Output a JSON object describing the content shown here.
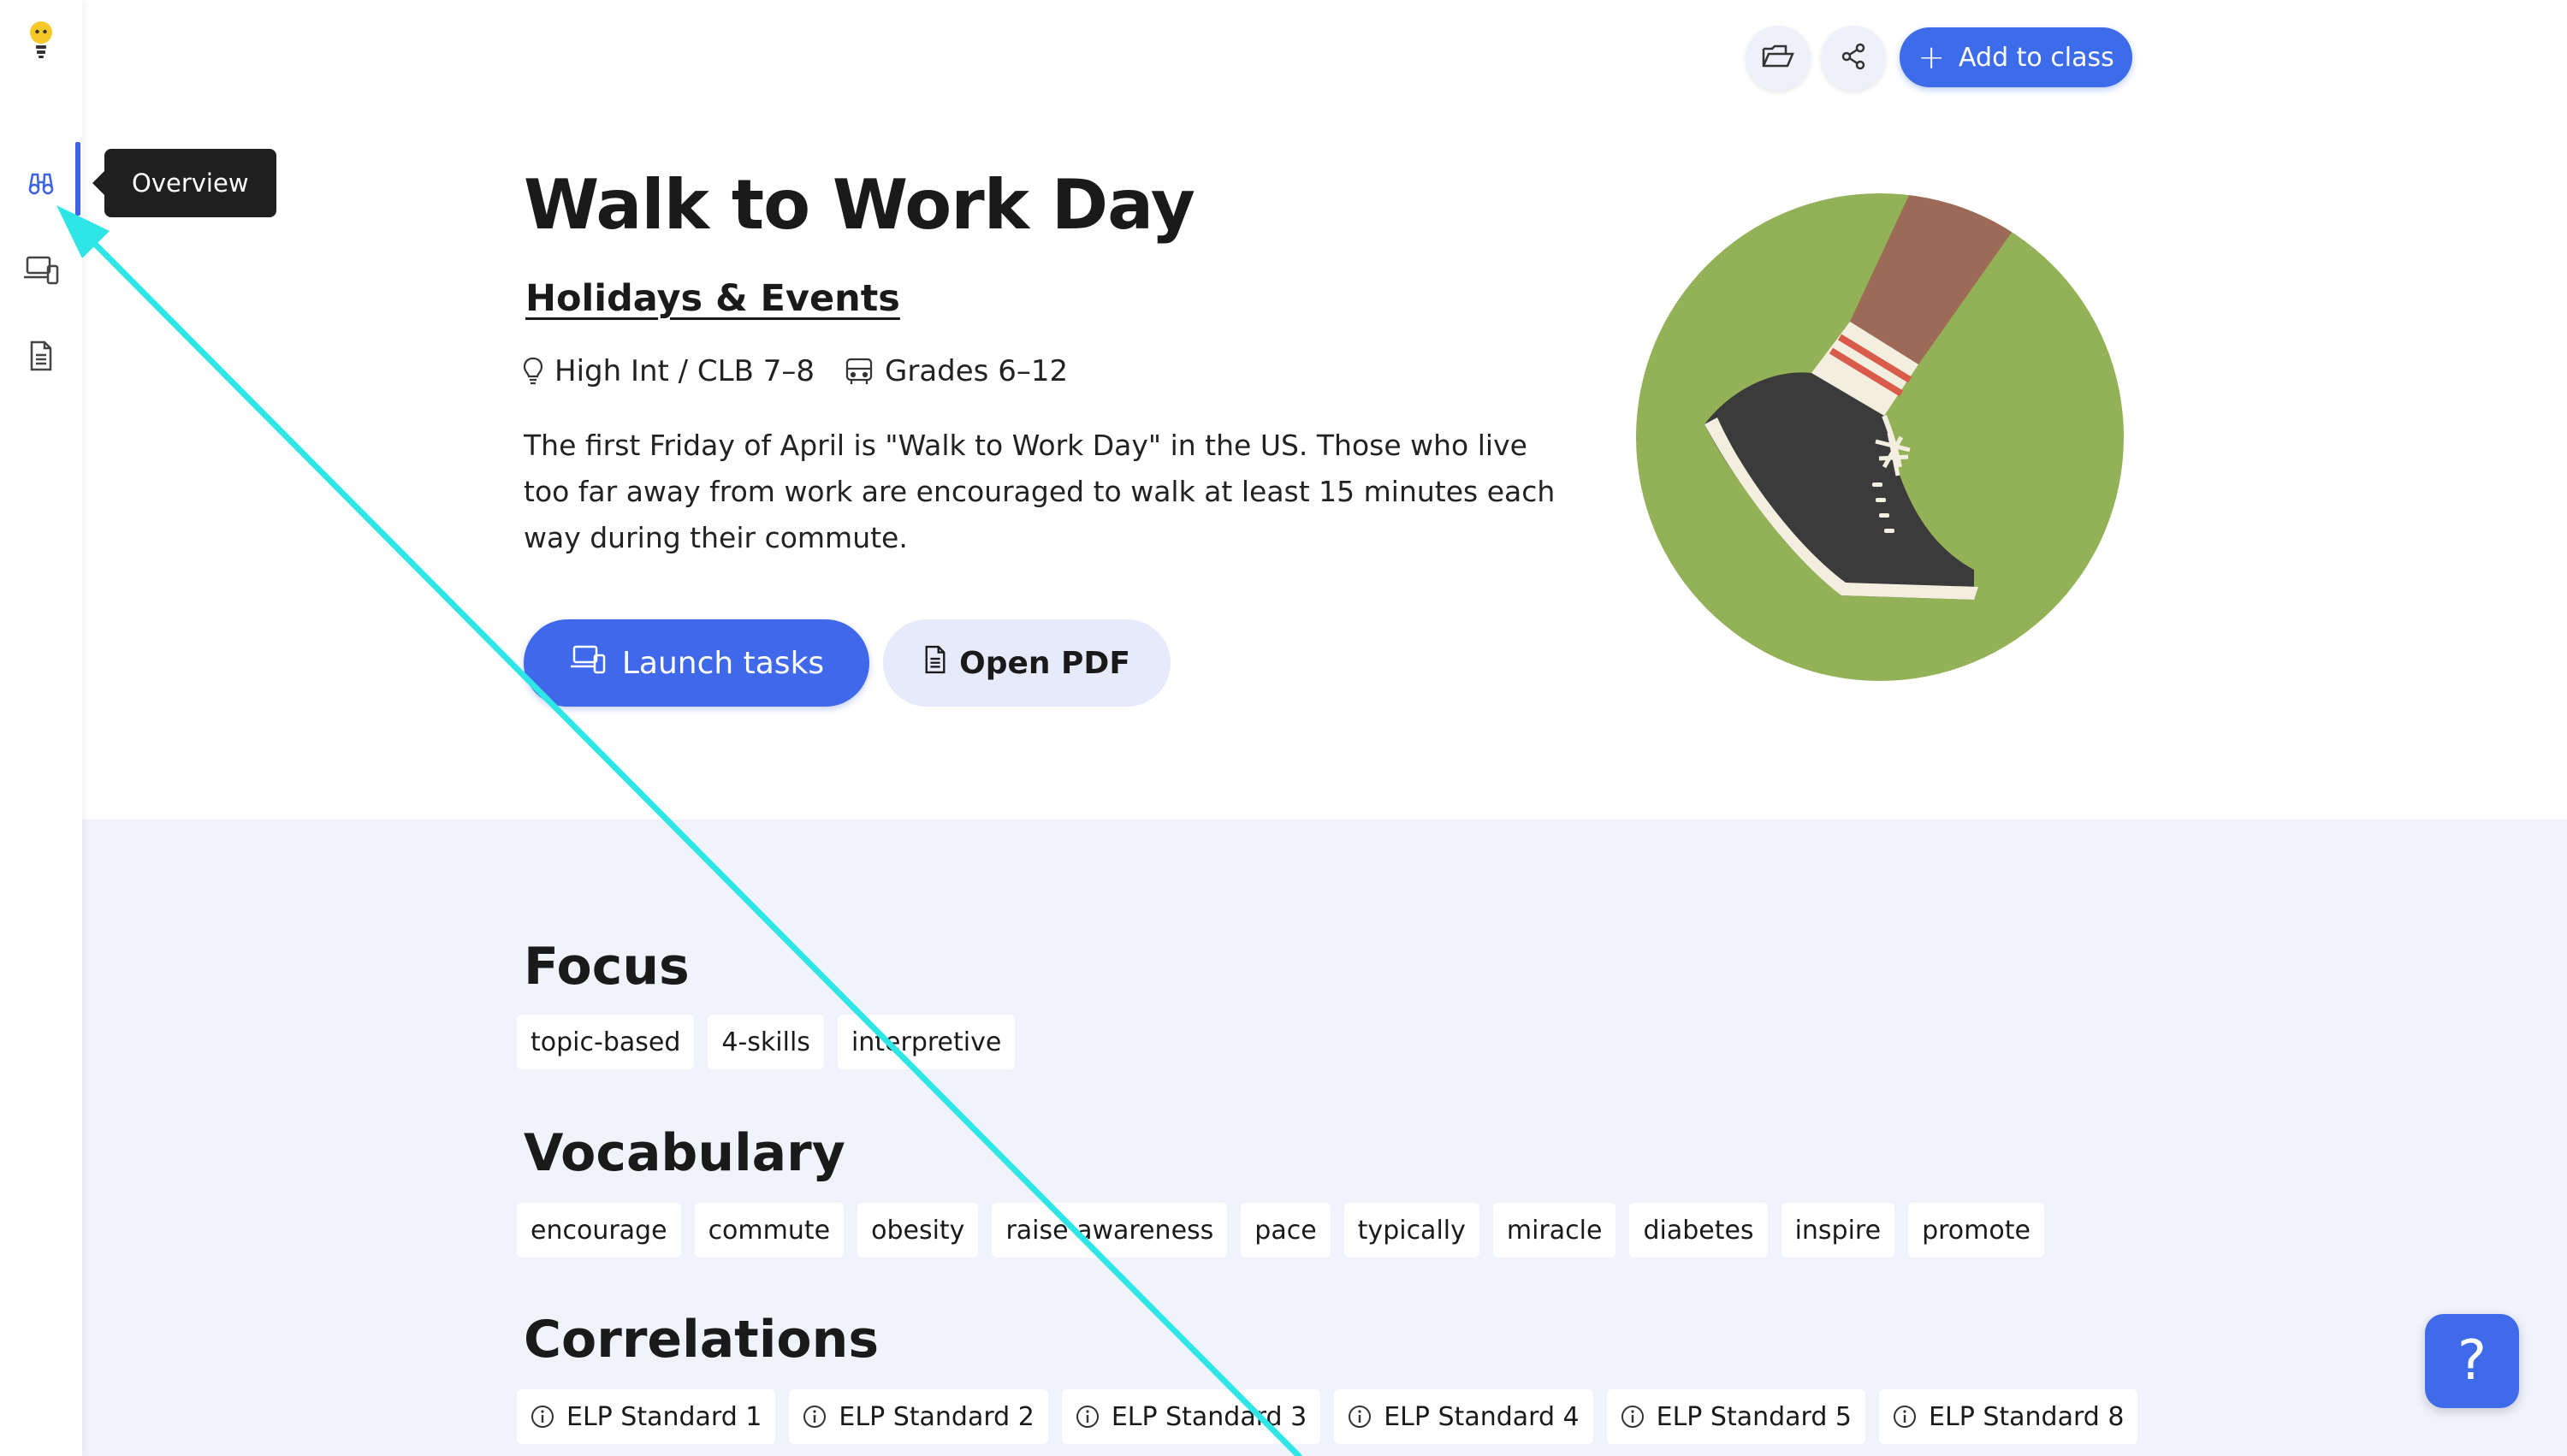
{
  "sidebar": {
    "items": [
      {
        "icon": "lightbulb-logo-icon"
      },
      {
        "icon": "binoculars-icon",
        "active": true
      },
      {
        "icon": "devices-icon"
      },
      {
        "icon": "document-icon"
      }
    ],
    "tooltip": "Overview"
  },
  "toolbar": {
    "folder_icon": "folder-open-icon",
    "share_icon": "share-icon",
    "add_label": "Add to class"
  },
  "lesson": {
    "title": "Walk to Work Day",
    "category": "Holidays & Events",
    "level": "High Int / CLB 7–8",
    "grades": "Grades 6–12",
    "description": "The first Friday of April is \"Walk to Work Day\" in the US. Those who live too far away from work are encouraged to walk at least 15 minutes each way during their commute.",
    "launch_label": "Launch tasks",
    "pdf_label": "Open PDF"
  },
  "focus": {
    "heading": "Focus",
    "tags": [
      "topic-based",
      "4-skills",
      "interpretive"
    ]
  },
  "vocabulary": {
    "heading": "Vocabulary",
    "words": [
      "encourage",
      "commute",
      "obesity",
      "raise awareness",
      "pace",
      "typically",
      "miracle",
      "diabetes",
      "inspire",
      "promote"
    ]
  },
  "correlations": {
    "heading": "Correlations",
    "items": [
      "ELP Standard 1",
      "ELP Standard 2",
      "ELP Standard 3",
      "ELP Standard 4",
      "ELP Standard 5",
      "ELP Standard 8"
    ]
  },
  "help": {
    "label": "?"
  },
  "colors": {
    "accent": "#3d6cea",
    "illustration_green": "#93b157",
    "lower_background": "#f0f3fc",
    "annotation_arrow": "#2ee6e6"
  }
}
